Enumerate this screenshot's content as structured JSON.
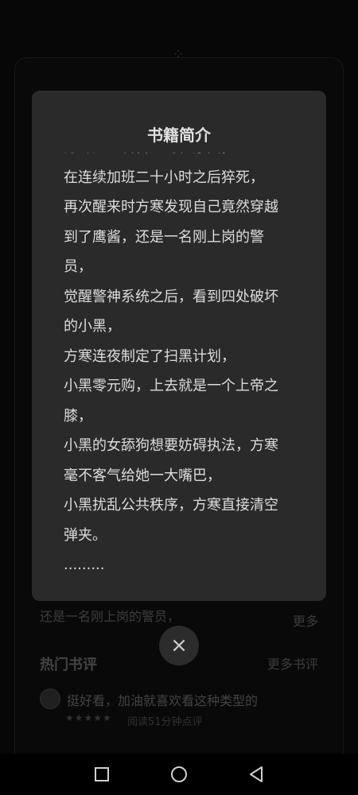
{
  "background": {
    "preview_line": "还是一名刚上岗的警员，",
    "more_label": "更多",
    "hot_reviews_title": "热门书评",
    "more_reviews_label": "更多书评",
    "review": {
      "text": "挺好看，加油就喜欢看这种类型的",
      "stars": "★★★★★",
      "meta": "阅读51分钟点评"
    }
  },
  "modal": {
    "title": "书籍简介",
    "lines": [
      "方寒是一名普通的程序员，",
      "在连续加班二十小时之后猝死，",
      "再次醒来时方寒发现自己竟然穿越",
      "到了鹰酱，还是一名刚上岗的警",
      "员，",
      "觉醒警神系统之后，看到四处破坏",
      "的小黑，",
      "方寒连夜制定了扫黑计划，",
      "小黑零元购，上去就是一个上帝之",
      "膝，",
      "小黑的女舔狗想要妨碍执法，方寒",
      "毫不客气给她一大嘴巴，",
      "小黑扰乱公共秩序，方寒直接清空",
      "弹夹。",
      "........."
    ],
    "close_icon": "×"
  },
  "colors": {
    "modal_bg": "#2a2a2a",
    "page_bg": "#0d0d0d"
  }
}
